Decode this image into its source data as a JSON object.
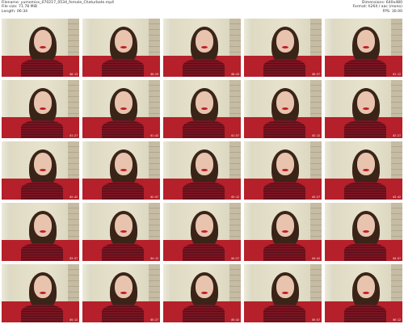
{
  "header": {
    "filename": "Filename: yumemiss_070217_0534_female_Chaturbate.mp4",
    "filesize": "File size: 71.78 MiB",
    "length": "Length: 06:34",
    "dimensions": "Dimensions: 640x480",
    "format": "Format: h264 / aac (mono)",
    "fps": "FPS: 30.00"
  },
  "thumbnails": [
    {
      "timestamp": "00:13"
    },
    {
      "timestamp": "00:29"
    },
    {
      "timestamp": "00:43"
    },
    {
      "timestamp": "00:57"
    },
    {
      "timestamp": "01:12"
    },
    {
      "timestamp": "01:27"
    },
    {
      "timestamp": "01:42"
    },
    {
      "timestamp": "01:57"
    },
    {
      "timestamp": "02:12"
    },
    {
      "timestamp": "02:27"
    },
    {
      "timestamp": "02:42"
    },
    {
      "timestamp": "02:57"
    },
    {
      "timestamp": "03:12"
    },
    {
      "timestamp": "03:27"
    },
    {
      "timestamp": "03:42"
    },
    {
      "timestamp": "03:57"
    },
    {
      "timestamp": "04:12"
    },
    {
      "timestamp": "04:27"
    },
    {
      "timestamp": "04:42"
    },
    {
      "timestamp": "04:57"
    },
    {
      "timestamp": "05:12"
    },
    {
      "timestamp": "05:27"
    },
    {
      "timestamp": "05:42"
    },
    {
      "timestamp": "05:57"
    },
    {
      "timestamp": "06:12"
    }
  ]
}
